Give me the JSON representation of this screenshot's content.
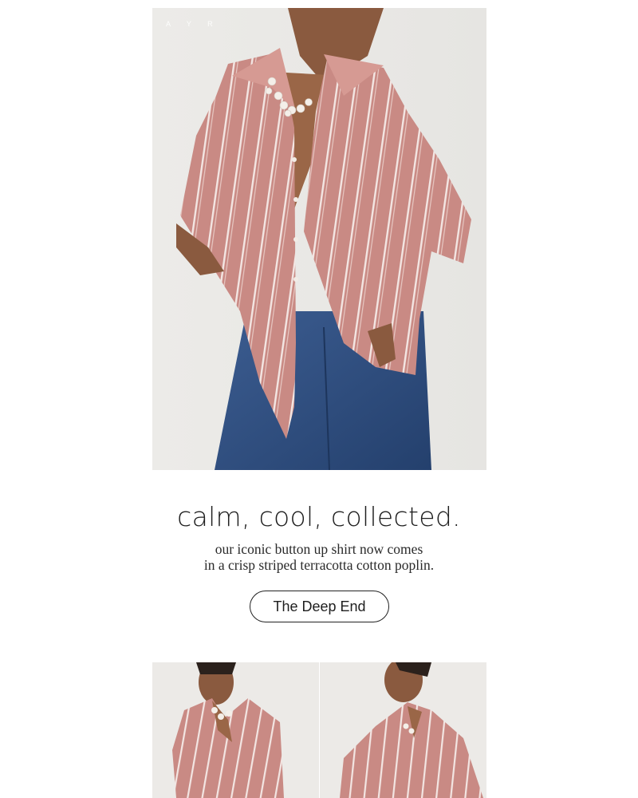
{
  "brand": {
    "logo_text": "A Y R"
  },
  "hero": {
    "image_desc": "model-in-striped-terracotta-shirt-and-jeans"
  },
  "copy": {
    "headline": "calm, cool, collected.",
    "line1": "our iconic button up shirt now comes",
    "line2": "in  a crisp striped terracotta cotton poplin."
  },
  "cta": {
    "label": "The Deep End"
  },
  "thumbnails": [
    {
      "image_desc": "model-front-view-striped-shirt"
    },
    {
      "image_desc": "model-side-profile-striped-shirt"
    }
  ],
  "colors": {
    "shirt": "#c98a84",
    "stripe": "#f3e6e3",
    "denim": "#2f4d7e",
    "background": "#eeedeb",
    "skin": "#8a5a3f",
    "text": "#1e1e1e"
  }
}
